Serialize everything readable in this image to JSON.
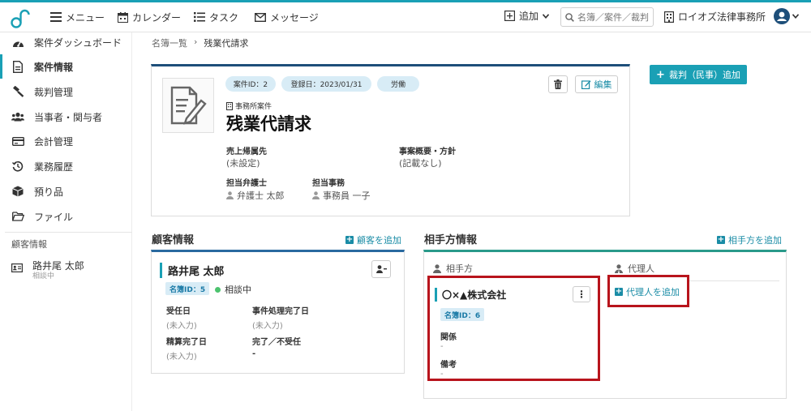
{
  "topbar": {
    "menu": "メニュー",
    "calendar": "カレンダー",
    "task": "タスク",
    "message": "メッセージ",
    "add": "追加",
    "search_placeholder": "名簿／案件／裁判",
    "firm": "ロイオズ法律事務所"
  },
  "sidebar": {
    "items": [
      {
        "label": "案件ダッシュボード",
        "icon": "dashboard-icon"
      },
      {
        "label": "案件情報",
        "icon": "document-icon"
      },
      {
        "label": "裁判管理",
        "icon": "gavel-icon"
      },
      {
        "label": "当事者・関与者",
        "icon": "people-icon"
      },
      {
        "label": "会計管理",
        "icon": "card-icon"
      },
      {
        "label": "業務履歴",
        "icon": "history-icon"
      },
      {
        "label": "預り品",
        "icon": "box-icon"
      },
      {
        "label": "ファイル",
        "icon": "folder-icon"
      }
    ],
    "section": "顧客情報",
    "client": {
      "name": "路井尾 太郎",
      "status": "相談中"
    }
  },
  "breadcrumb": {
    "root": "名簿一覧",
    "sep": "›",
    "current": "残業代請求"
  },
  "case": {
    "pill_id": "案件ID：2",
    "pill_date": "登録日：2023/01/31",
    "pill_cat": "労働",
    "edit": "編集",
    "kind": "事務所案件",
    "title": "残業代請求",
    "sales_label": "売上帰属先",
    "sales_value": "(未設定)",
    "summary_label": "事案概要・方針",
    "summary_value": "(記載なし)",
    "lawyer_label": "担当弁護士",
    "lawyer": "弁護士 太郎",
    "staff_label": "担当事務",
    "staff": "事務員 一子"
  },
  "add_trial": "裁判（民事）追加",
  "client_section": {
    "title": "顧客情報",
    "add_link": "顧客を追加",
    "name": "路井尾 太郎",
    "id_badge": "名簿ID：5",
    "status": "相談中",
    "fields": {
      "received_label": "受任日",
      "received_value": "(未入力)",
      "done_label": "事件処理完了日",
      "done_value": "(未入力)",
      "settle_label": "精算完了日",
      "settle_value": "(未入力)",
      "complete_label": "完了／不受任",
      "complete_value": "-"
    }
  },
  "opp_section": {
    "title": "相手方情報",
    "add_link": "相手方を追加",
    "col_opponent": "相手方",
    "col_agent": "代理人",
    "company": "〇×▲株式会社",
    "id_badge": "名簿ID：6",
    "relation_label": "関係",
    "relation_value": "-",
    "note_label": "備考",
    "note_value": "-",
    "kebab": "⋮",
    "add_agent": "代理人を追加"
  },
  "colors": {
    "accent": "#1aa0b5",
    "highlight": "#b8141c",
    "navy": "#1e4f7a"
  }
}
